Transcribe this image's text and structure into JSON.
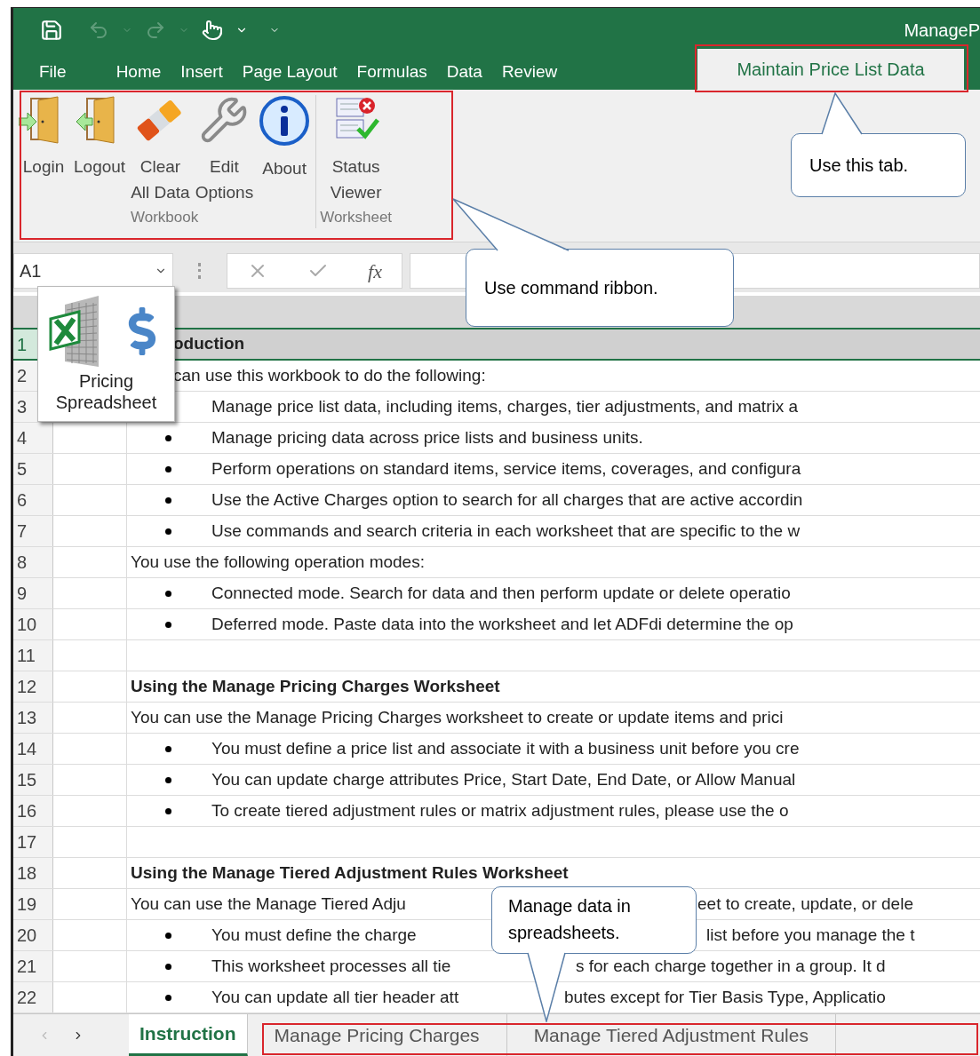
{
  "title_bar": {
    "title": "ManageP"
  },
  "ribbon_tabs": [
    {
      "label": "File",
      "selected": false
    },
    {
      "label": "Home",
      "selected": false
    },
    {
      "label": "Insert",
      "selected": false
    },
    {
      "label": "Page Layout",
      "selected": false
    },
    {
      "label": "Formulas",
      "selected": false
    },
    {
      "label": "Data",
      "selected": false
    },
    {
      "label": "Review",
      "selected": false
    },
    {
      "label": "Maintain Price List Data",
      "selected": true
    }
  ],
  "ribbon_groups": [
    {
      "label": "Workbook",
      "buttons": [
        {
          "kind": "login",
          "label": "Login"
        },
        {
          "kind": "logout",
          "label": "Logout"
        },
        {
          "kind": "clear",
          "label": "Clear\nAll Data"
        },
        {
          "kind": "edit",
          "label": "Edit\nOptions"
        },
        {
          "kind": "about",
          "label": "About"
        }
      ]
    },
    {
      "label": "Worksheet",
      "buttons": [
        {
          "kind": "status",
          "label": "Status\nViewer"
        }
      ]
    }
  ],
  "formula_bar": {
    "name_box": "A1",
    "function_label": "fx"
  },
  "addin_tile": {
    "label": "Pricing Spreadsheet"
  },
  "rows": [
    {
      "number": "1",
      "kind": "heading",
      "text": "oduction",
      "clipped_left": true,
      "selected": true
    },
    {
      "number": "2",
      "kind": "text",
      "text": "can use this workbook to do the following:",
      "clipped_left": true,
      "selected": false
    },
    {
      "number": "3",
      "kind": "indented",
      "text": "Manage price list data, including items, charges, tier adjustments, and matrix a",
      "selected": false
    },
    {
      "number": "4",
      "kind": "bullet",
      "text": "Manage pricing data across price lists and business units.",
      "selected": false
    },
    {
      "number": "5",
      "kind": "bullet",
      "text": "Perform operations on standard items, service items, coverages, and configura",
      "selected": false
    },
    {
      "number": "6",
      "kind": "bullet",
      "text": "Use the Active Charges option to search for all charges that are active accordin",
      "selected": false
    },
    {
      "number": "7",
      "kind": "bullet",
      "text": "Use commands and search criteria in each worksheet that are specific to the w",
      "selected": false
    },
    {
      "number": "8",
      "kind": "text",
      "text": "You use the following operation modes:",
      "selected": false
    },
    {
      "number": "9",
      "kind": "bullet",
      "text": "Connected mode. Search for data and then perform update or delete operatio",
      "selected": false
    },
    {
      "number": "10",
      "kind": "bullet",
      "text": "Deferred mode. Paste data into the worksheet and let ADFdi determine the op",
      "selected": false
    },
    {
      "number": "11",
      "kind": "blank",
      "selected": false
    },
    {
      "number": "12",
      "kind": "subheading",
      "text": "Using the Manage Pricing Charges Worksheet",
      "selected": false
    },
    {
      "number": "13",
      "kind": "text",
      "text": "You can use the Manage Pricing Charges worksheet to create or update items and prici",
      "selected": false
    },
    {
      "number": "14",
      "kind": "bullet",
      "text": "You must define a price list and associate it with a business unit before you cre",
      "selected": false
    },
    {
      "number": "15",
      "kind": "bullet",
      "text": "You can update charge attributes Price, Start Date, End Date, or Allow Manual",
      "selected": false
    },
    {
      "number": "16",
      "kind": "bullet",
      "text": "To create tiered adjustment rules or matrix adjustment rules, please use the o",
      "selected": false
    },
    {
      "number": "17",
      "kind": "blank",
      "selected": false
    },
    {
      "number": "18",
      "kind": "subheading",
      "text": "Using the Manage Tiered Adjustment Rules Worksheet",
      "selected": false
    },
    {
      "number": "19",
      "kind": "text",
      "text": "You can use the Manage Tiered Adju",
      "text_after": "eet to create, update, or dele",
      "selected": false
    },
    {
      "number": "20",
      "kind": "bullet",
      "text": "You must define the charge",
      "text_after": "list before you manage the t",
      "selected": false
    },
    {
      "number": "21",
      "kind": "bullet",
      "text": "This worksheet processes all tie",
      "text_after": "s for each charge together in a group. It d",
      "selected": false
    },
    {
      "number": "22",
      "kind": "bullet",
      "text": "You can update all tier header att",
      "text_after": "butes except for Tier Basis Type, Applicatio",
      "selected": false
    }
  ],
  "sheet_tabs": [
    {
      "label": "Instruction",
      "selected": true
    },
    {
      "label": "Manage Pricing Charges",
      "selected": false
    },
    {
      "label": "Manage Tiered Adjustment Rules",
      "selected": false
    }
  ],
  "callouts": [
    {
      "text": "Use this tab."
    },
    {
      "text": "Use command ribbon."
    },
    {
      "text": "Manage data in spreadsheets."
    }
  ]
}
